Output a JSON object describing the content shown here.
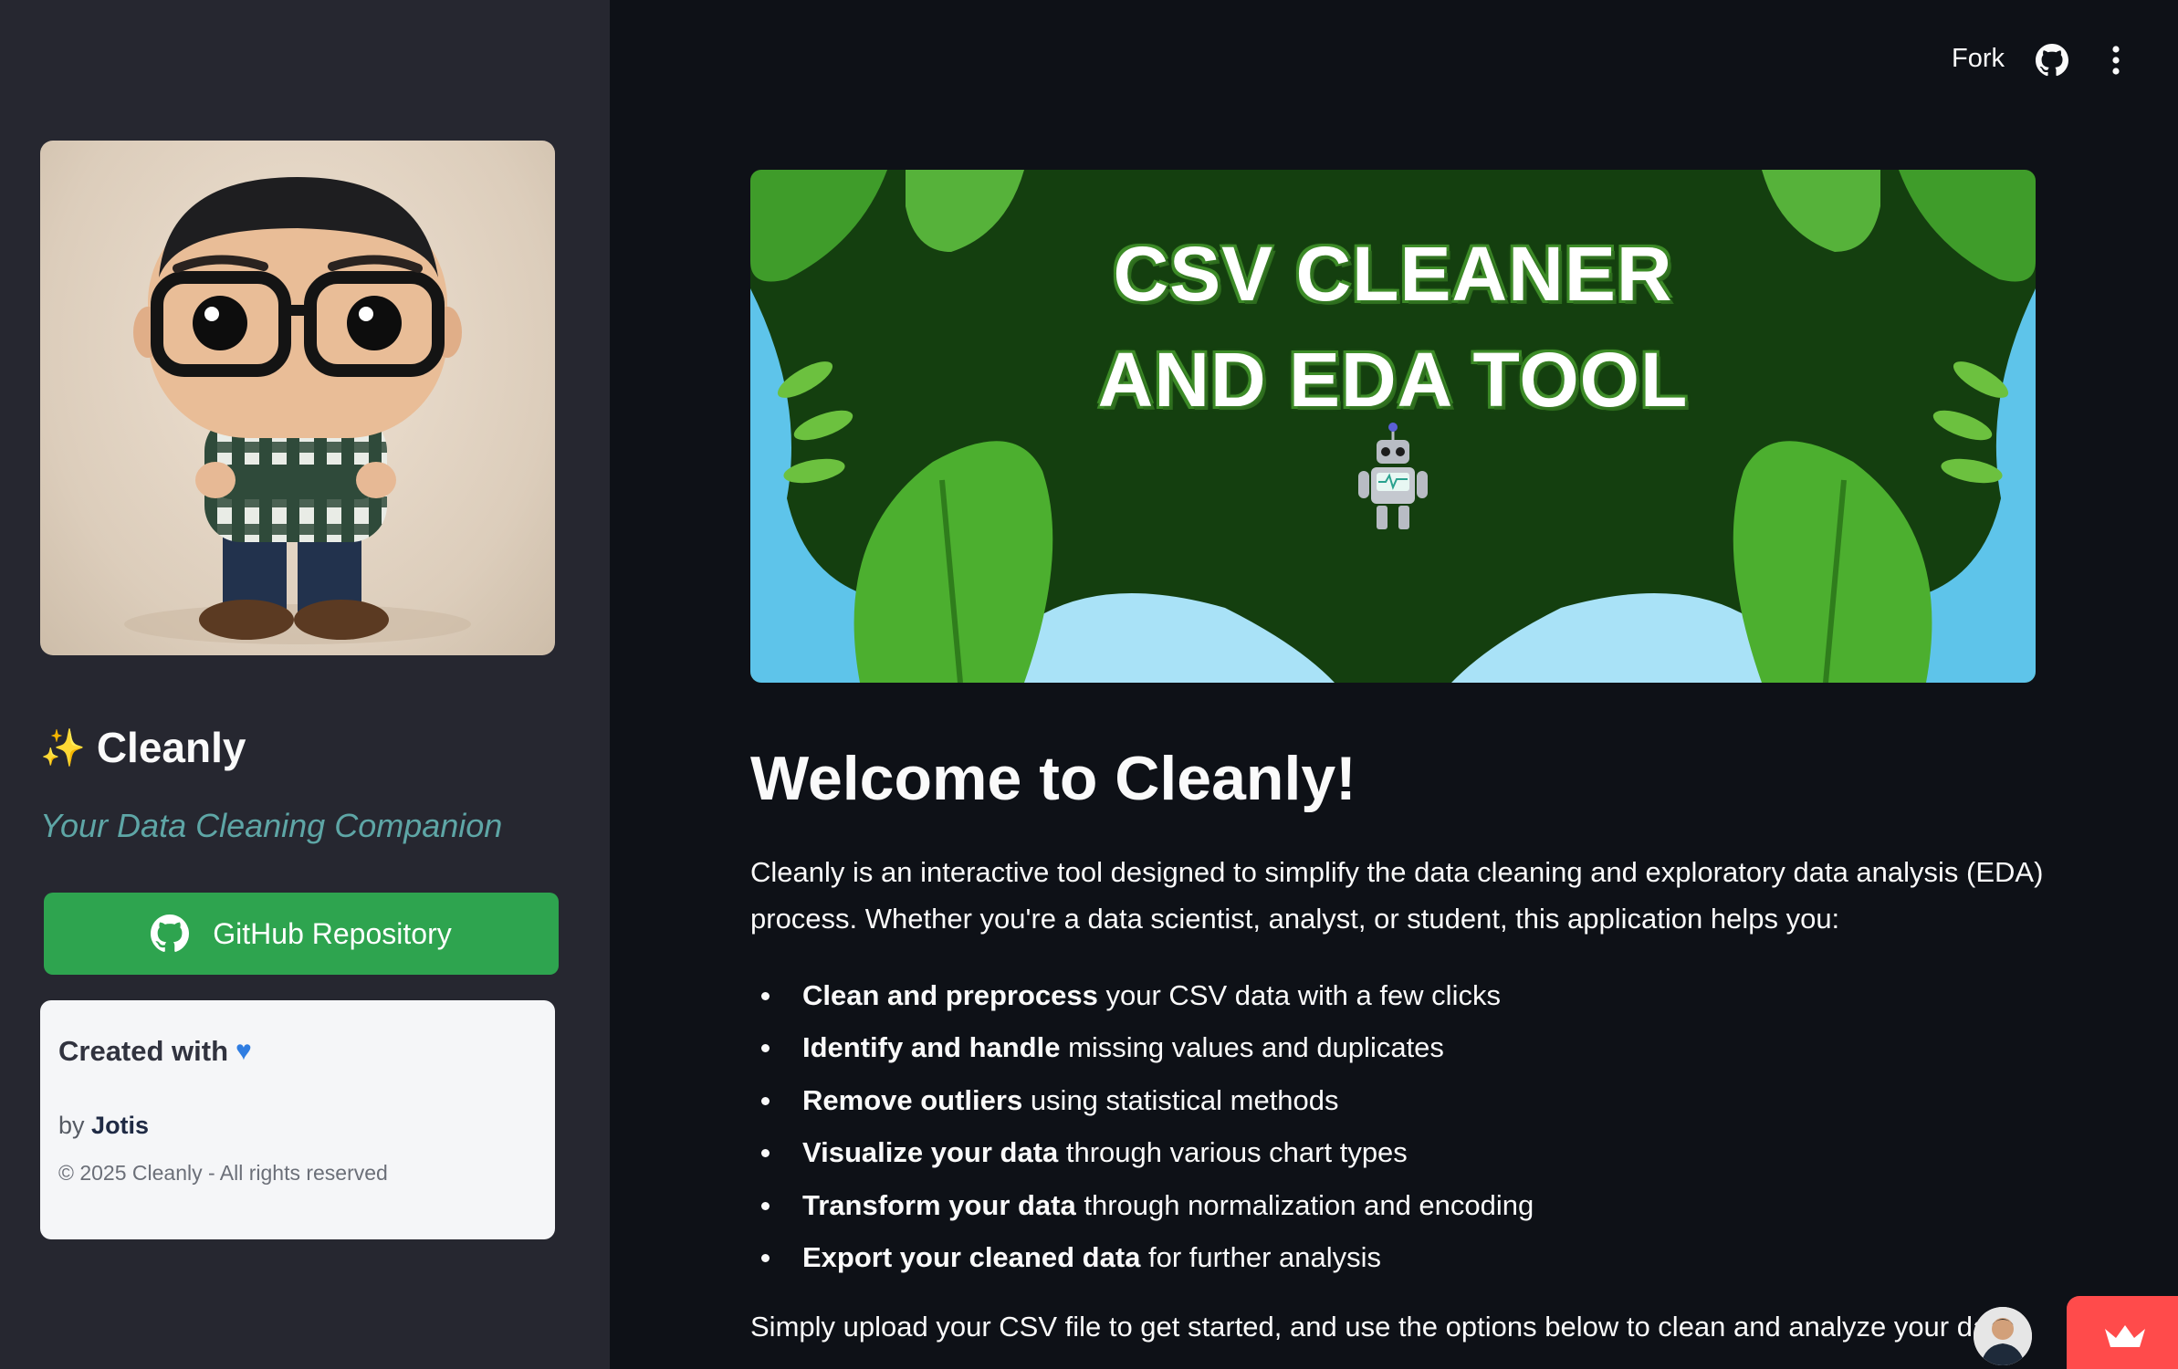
{
  "header": {
    "fork_label": "Fork",
    "github_icon": "github-icon",
    "menu_icon": "kebab-menu-icon"
  },
  "sidebar": {
    "avatar_alt": "Profile figure",
    "title_icon": "sparkles-icon",
    "title": "Cleanly",
    "tagline": "Your Data Cleaning Companion",
    "github_button_label": "GitHub Repository",
    "credit": {
      "created_with": "Created with",
      "heart_icon": "blue-heart-icon",
      "by_prefix": "by",
      "author": "Jotis",
      "copyright": "© 2025 Cleanly - All rights reserved"
    }
  },
  "banner": {
    "line1": "CSV CLEANER",
    "line2": "AND EDA TOOL",
    "robot_icon": "robot-icon"
  },
  "main": {
    "heading": "Welcome to Cleanly!",
    "intro": "Cleanly is an interactive tool designed to simplify the data cleaning and exploratory data analysis (EDA) process. Whether you're a data scientist, analyst, or student, this application helps you:",
    "features": [
      {
        "bold": "Clean and preprocess",
        "rest": " your CSV data with a few clicks"
      },
      {
        "bold": "Identify and handle",
        "rest": " missing values and duplicates"
      },
      {
        "bold": "Remove outliers",
        "rest": " using statistical methods"
      },
      {
        "bold": "Visualize your data",
        "rest": " through various chart types"
      },
      {
        "bold": "Transform your data",
        "rest": " through normalization and encoding"
      },
      {
        "bold": "Export your cleaned data",
        "rest": " for further analysis"
      }
    ],
    "cta": "Simply upload your CSV file to get started, and use the options below to clean and analyze your data!"
  },
  "colors": {
    "background": "#0e1117",
    "sidebar": "#262730",
    "github_button": "#2ea44f",
    "tagline": "#5ea6a6",
    "deploy_badge": "#ff4b4b"
  }
}
